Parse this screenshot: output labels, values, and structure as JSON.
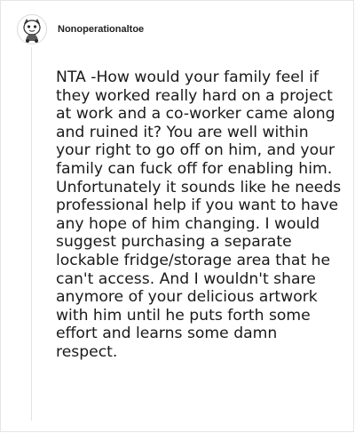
{
  "comment": {
    "author": "Nonoperationaltoe",
    "avatar_icon": "cartoon-character-avatar",
    "text": "NTA -How would your family feel if they worked really hard on a project at work and a co-worker came along and ruined it? You are well within your right to go off on him, and your family can fuck off for enabling him. Unfortunately it sounds like he needs professional help if you want to have any hope of him changing. I would suggest purchasing a separate lockable fridge/storage area that he can't access. And I wouldn't share anymore of your delicious artwork with him until he puts forth some effort and learns some damn respect."
  },
  "colors": {
    "text": "#1a1a1a",
    "username": "#222222",
    "border": "#e6e6e6",
    "thread_line": "#e3e3e3"
  }
}
